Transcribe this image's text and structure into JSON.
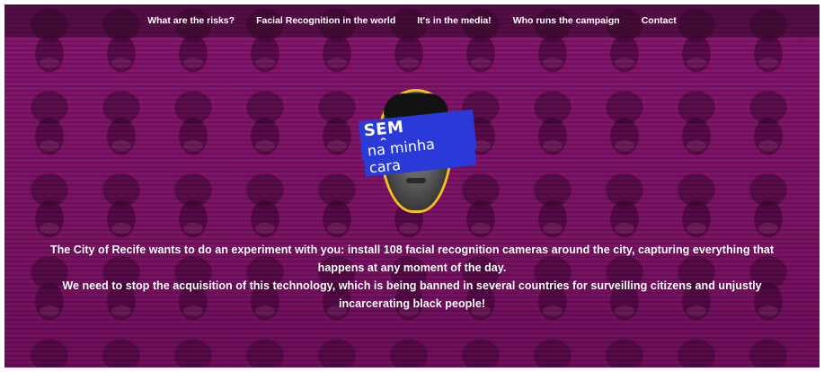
{
  "nav": {
    "items": [
      {
        "label": "What are the risks?"
      },
      {
        "label": "Facial Recognition in the world"
      },
      {
        "label": "It's in the media!"
      },
      {
        "label": "Who runs the campaign"
      },
      {
        "label": "Contact"
      }
    ]
  },
  "logo": {
    "line1": "SEM CÂMERA",
    "line2": "na minha cara"
  },
  "hero": {
    "paragraph1": "The City of Recife wants to do an experiment with you: install 108 facial recognition cameras around the city, capturing everything that happens at any moment of the day.",
    "paragraph2": "We need to stop the acquisition of this technology, which is being banned in several countries for surveilling citizens and unjustly incarcerating black people!"
  },
  "colors": {
    "background_magenta": "#7a1466",
    "label_blue": "#2a3ad9",
    "outline_yellow": "#f2c21b"
  }
}
